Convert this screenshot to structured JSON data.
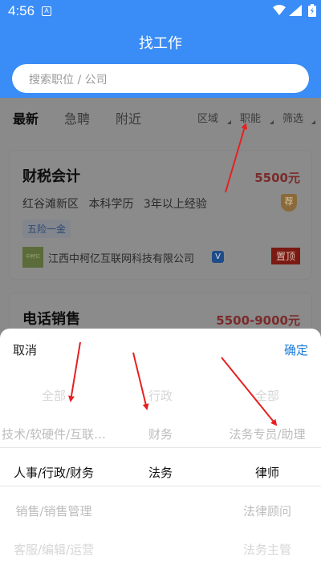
{
  "status_bar": {
    "time": "4:56",
    "notification_badge": "A"
  },
  "header": {
    "title": "找工作",
    "search_placeholder": "搜索职位 / 公司"
  },
  "tabs": [
    {
      "label": "最新",
      "active": true
    },
    {
      "label": "急聘",
      "active": false
    },
    {
      "label": "附近",
      "active": false
    }
  ],
  "filters": [
    {
      "label": "区域"
    },
    {
      "label": "职能"
    },
    {
      "label": "筛选"
    }
  ],
  "jobs": [
    {
      "title": "财税会计",
      "salary": "5500元",
      "location": "红谷滩新区",
      "education": "本科学历",
      "experience": "3年以上经验",
      "tag": "五险一金",
      "company": "江西中柯亿互联网科技有限公司",
      "logo_text": "中柯亿",
      "top_badge": "置顶"
    },
    {
      "title": "电话销售",
      "salary": "5500-9000元"
    }
  ],
  "picker": {
    "cancel_label": "取消",
    "confirm_label": "确定",
    "col1": [
      "全部",
      "技术/软硬件/互联…",
      "人事/行政/财务",
      "销售/销售管理",
      "客服/编辑/运营"
    ],
    "col2": [
      "行政",
      "财务",
      "法务",
      "",
      ""
    ],
    "col3": [
      "全部",
      "法务专员/助理",
      "律师",
      "法律顾问",
      "法务主管"
    ]
  },
  "colors": {
    "primary": "#3a8cf6",
    "confirm": "#1a7bd8",
    "annotation_arrow": "#e62020"
  }
}
